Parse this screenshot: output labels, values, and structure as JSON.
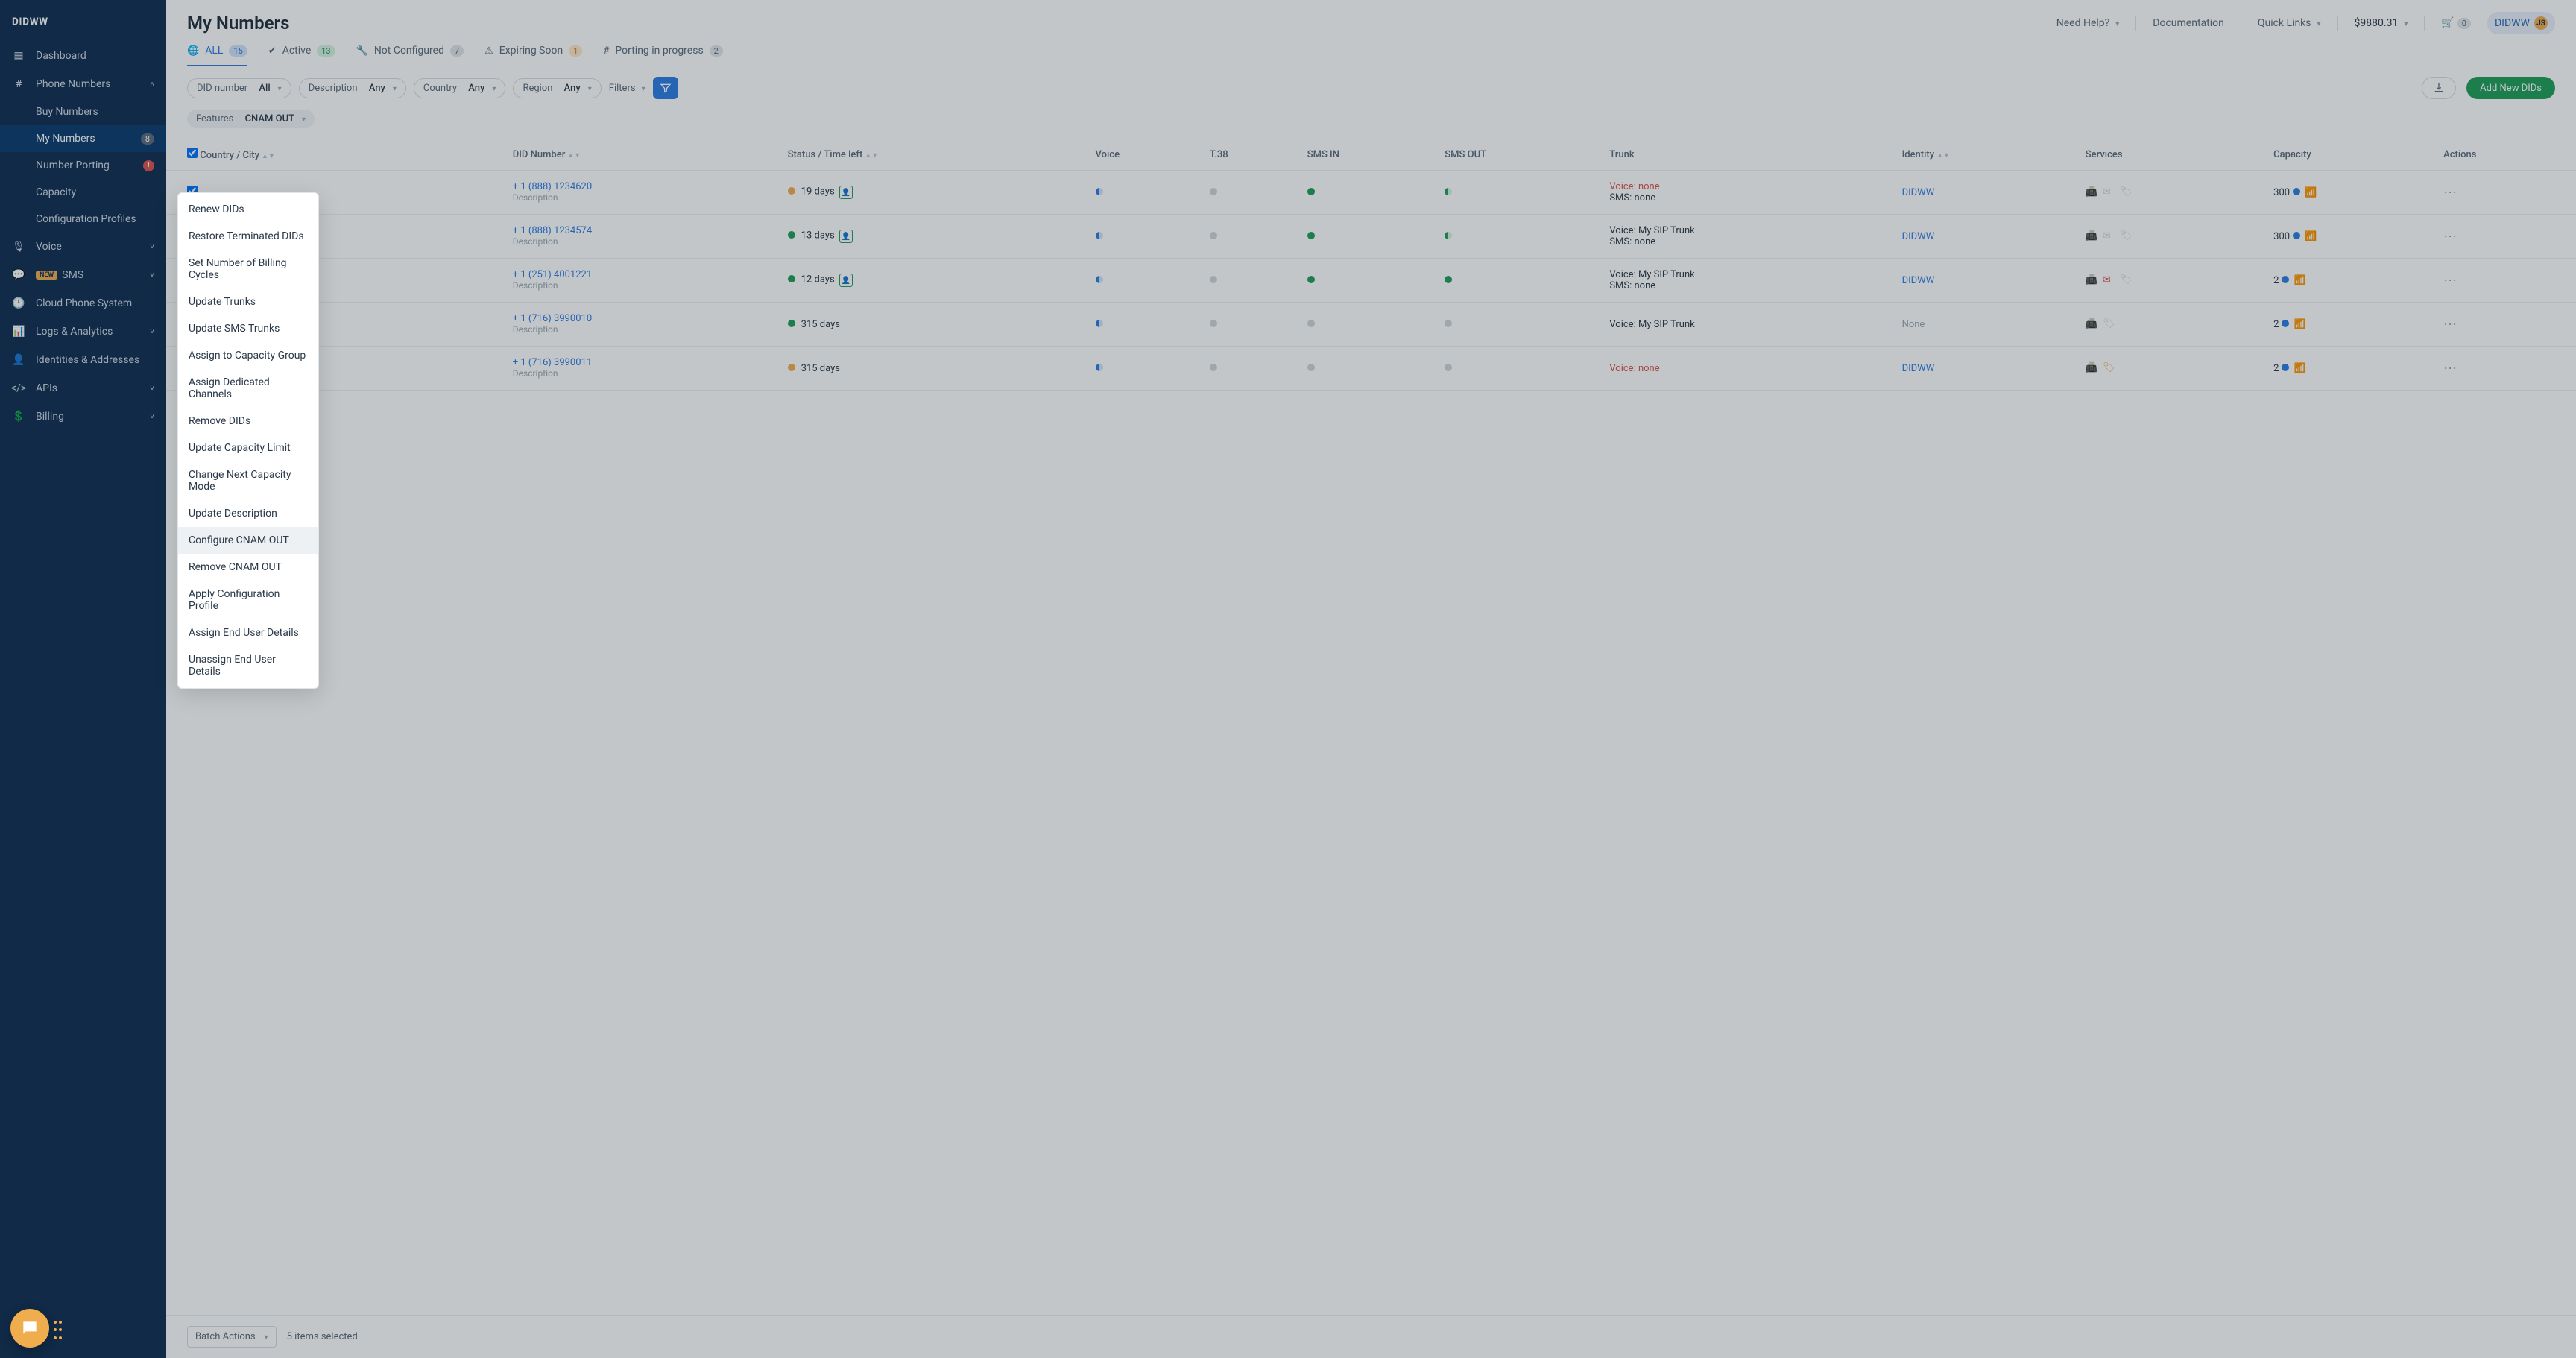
{
  "brand": "DIDWW",
  "page_title": "My Numbers",
  "topbar": {
    "need_help": "Need Help?",
    "documentation": "Documentation",
    "quick_links": "Quick Links",
    "balance": "$9880.31",
    "cart_count": "0",
    "user_label": "DIDWW",
    "user_initials": "JS"
  },
  "sidebar": {
    "items": [
      {
        "label": "Dashboard"
      },
      {
        "label": "Phone Numbers",
        "expanded": true,
        "children": [
          {
            "label": "Buy Numbers"
          },
          {
            "label": "My Numbers",
            "badge": "8",
            "active": true
          },
          {
            "label": "Number Porting",
            "badge": "!",
            "badgeRed": true
          },
          {
            "label": "Capacity"
          },
          {
            "label": "Configuration Profiles"
          }
        ]
      },
      {
        "label": "Voice"
      },
      {
        "label": "SMS",
        "new": true
      },
      {
        "label": "Cloud Phone System"
      },
      {
        "label": "Logs & Analytics"
      },
      {
        "label": "Identities & Addresses"
      },
      {
        "label": "APIs"
      },
      {
        "label": "Billing"
      }
    ]
  },
  "tabs": [
    {
      "label": "ALL",
      "count": "15",
      "active": true,
      "countClass": "blue"
    },
    {
      "label": "Active",
      "count": "13",
      "countClass": "green"
    },
    {
      "label": "Not Configured",
      "count": "7"
    },
    {
      "label": "Expiring Soon",
      "count": "1",
      "countClass": "orange"
    },
    {
      "label": "Porting in progress",
      "count": "2"
    }
  ],
  "filters": {
    "did_label": "DID number",
    "did_value": "All",
    "desc_label": "Description",
    "desc_value": "Any",
    "country_label": "Country",
    "country_value": "Any",
    "region_label": "Region",
    "region_value": "Any",
    "filters_label": "Filters",
    "features_label": "Features",
    "features_value": "CNAM OUT",
    "download_tooltip": "Download",
    "add_label": "Add New DIDs"
  },
  "columns": {
    "country": "Country / City",
    "did": "DID Number",
    "status": "Status / Time left",
    "voice": "Voice",
    "t38": "T.38",
    "sms_in": "SMS IN",
    "sms_out": "SMS OUT",
    "trunk": "Trunk",
    "identity": "Identity",
    "services": "Services",
    "capacity": "Capacity",
    "actions": "Actions"
  },
  "rows": [
    {
      "did": "+ 1 (888) 1234620",
      "desc": "Description",
      "status_color": "yellow",
      "time": "19 days",
      "user": true,
      "voice": "half-blue",
      "t38": "grey",
      "sms_in": "green",
      "sms_out": "half",
      "trunk_voice": "Voice: none",
      "trunk_voice_none": true,
      "trunk_sms": "SMS: none",
      "identity": "DIDWW",
      "svc_mail_red": false,
      "svc_tag": false,
      "capacity": "300"
    },
    {
      "did": "+ 1 (888) 1234574",
      "desc": "Description",
      "status_color": "green",
      "time": "13 days",
      "user": true,
      "voice": "half-blue",
      "t38": "grey",
      "sms_in": "green",
      "sms_out": "half",
      "trunk_voice": "Voice: My SIP Trunk",
      "trunk_sms": "SMS: none",
      "identity": "DIDWW",
      "svc_mail_red": false,
      "svc_tag": false,
      "capacity": "300"
    },
    {
      "did": "+ 1 (251) 4001221",
      "desc": "Description",
      "status_color": "green",
      "time": "12 days",
      "user": true,
      "voice": "half-blue",
      "t38": "grey",
      "sms_in": "green",
      "sms_out": "green",
      "trunk_voice": "Voice: My SIP Trunk",
      "trunk_sms": "SMS: none",
      "identity": "DIDWW",
      "svc_mail_red": true,
      "svc_tag": false,
      "capacity": "2"
    },
    {
      "did": "+ 1 (716) 3990010",
      "desc": "Description",
      "status_color": "green",
      "time": "315 days",
      "user": false,
      "voice": "half-blue",
      "t38": "grey",
      "sms_in": "grey",
      "sms_out": "grey",
      "trunk_voice": "Voice: My SIP Trunk",
      "trunk_sms": "",
      "identity": "None",
      "identity_none": true,
      "svc_hide_mail": true,
      "svc_tag": false,
      "capacity": "2"
    },
    {
      "did": "+ 1 (716) 3990011",
      "desc": "Description",
      "status_color": "yellow",
      "time": "315 days",
      "user": false,
      "voice": "half-blue",
      "t38": "grey",
      "sms_in": "grey",
      "sms_out": "grey",
      "trunk_voice": "Voice: none",
      "trunk_voice_none": true,
      "trunk_sms": "",
      "identity": "DIDWW",
      "svc_hide_mail": true,
      "svc_tag_orange": true,
      "capacity": "2"
    }
  ],
  "dropdown": [
    "Renew DIDs",
    "Restore Terminated DIDs",
    "Set Number of Billing Cycles",
    "Update Trunks",
    "Update SMS Trunks",
    "Assign to Capacity Group",
    "Assign Dedicated Channels",
    "Remove DIDs",
    "Update Capacity Limit",
    "Change Next Capacity Mode",
    "Update Description",
    "Configure CNAM OUT",
    "Remove CNAM OUT",
    "Apply Configuration Profile",
    "Assign End User Details",
    "Unassign End User Details"
  ],
  "dropdown_hover_index": 11,
  "footer": {
    "batch_label": "Batch Actions",
    "selected_text": "5 items selected"
  }
}
